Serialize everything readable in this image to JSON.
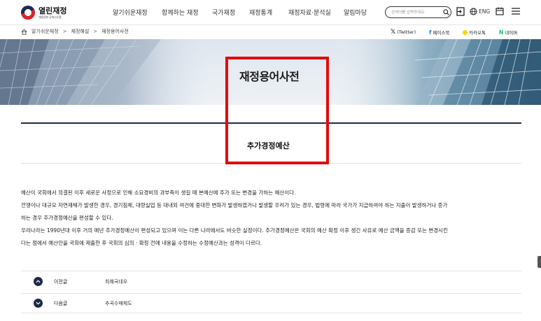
{
  "header": {
    "logo_title": "열린재정",
    "logo_sub": "재정정보 공개시스템",
    "nav": [
      "알기쉬운재정",
      "함께하는 재정",
      "국가재정",
      "재정통계",
      "재정자료·분석실",
      "알림마당"
    ],
    "search_placeholder": "검색어를 입력하세요.",
    "lang": "ENG"
  },
  "breadcrumb": {
    "items": [
      "알기쉬운재정",
      "재정해설",
      "재정용어사전"
    ]
  },
  "share": {
    "twitter": "(Twitter)",
    "facebook": "페이스북",
    "kakao": "카카오톡",
    "naver": "네이버"
  },
  "hero": {
    "title": "재정용어사전"
  },
  "term": {
    "title": "추가경정예산"
  },
  "description": [
    "예산이 국회에서 의결된 이후 새로운 사정으로 인해 소요경비의 과부족이 생길 때 본예산에 추가 또는 변경을 가하는 예산이다.",
    "전쟁이나 대규모 자연재해가 발생한 경우, 경기침체, 대량실업 등 대내외 여건에 중대한 변화가 발생하였거나 발생할 우려가 있는 경우, 법령에 따라 국가가 지급하여야 하는 지출이 발생하거나 증가",
    "하는 경우 추가경정예산을 편성할 수 있다.",
    "우리나라는 1990년대 이후 거의 매년 추가경정예산이 편성되고 있으며 이는 다른 나라에서도 비슷한 실정이다. 추가경정예산은 국회의 예산 확정 이후 생긴 사유로 예산 금액을 증감 또는 변경시킨",
    "다는 점에서 예산안을 국회에 제출한 후 국회의 심의 · 확정 전에 내용을 수정하는 수정예산과는 성격이 다르다."
  ],
  "pager": {
    "prev_label": "이전글",
    "prev_term": "최혜국대우",
    "next_label": "다음글",
    "next_term": "추곡수매제도"
  },
  "colors": {
    "navy": "#1c2a4a",
    "highlight": "#e20b0b"
  }
}
